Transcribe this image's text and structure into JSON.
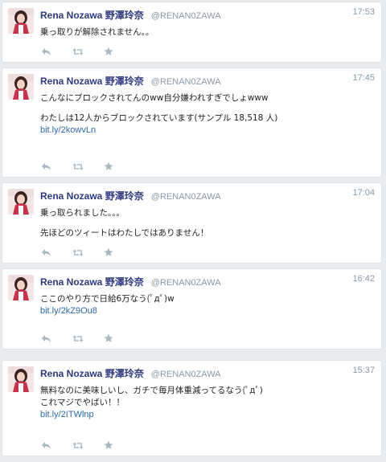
{
  "tweets": [
    {
      "name": "Rena Nozawa 野澤玲奈",
      "handle": "@RENAN0ZAWA",
      "time": "17:53",
      "text1": "乗っ取りが解除されません。。",
      "text2": "",
      "link": ""
    },
    {
      "name": "Rena Nozawa 野澤玲奈",
      "handle": "@RENAN0ZAWA",
      "time": "17:45",
      "text1": "こんなにブロックされてんのww自分嫌われすぎでしょwww",
      "text2": "わたしは12人からブロックされています(サンプル 18,518 人)",
      "link": "bit.ly/2kowvLn"
    },
    {
      "name": "Rena Nozawa 野澤玲奈",
      "handle": "@RENAN0ZAWA",
      "time": "17:04",
      "text1": "乗っ取られました。。。",
      "text2": "先ほどのツィートはわたしではありません！",
      "link": ""
    },
    {
      "name": "Rena Nozawa 野澤玲奈",
      "handle": "@RENAN0ZAWA",
      "time": "16:42",
      "text1": "ここのやり方で日給6万なう(ﾟдﾟ)w",
      "text2": "",
      "link": "bit.ly/2kZ9Ou8"
    },
    {
      "name": "Rena Nozawa 野澤玲奈",
      "handle": "@RENAN0ZAWA",
      "time": "15:37",
      "text1": "無料なのに美味しいし、ガチで毎月体重減ってるなう(ﾟдﾟ)",
      "text2": "これマジでやばい！！",
      "link": "bit.ly/2ITWlnp"
    }
  ],
  "icons": {
    "reply": "reply-icon",
    "retweet": "retweet-icon",
    "favorite": "star-icon"
  },
  "colors": {
    "name": "#2d3a7e",
    "handle": "#8899a6",
    "link": "#2c6aa9",
    "icon": "#aab8c2",
    "background": "#e9ecee"
  }
}
